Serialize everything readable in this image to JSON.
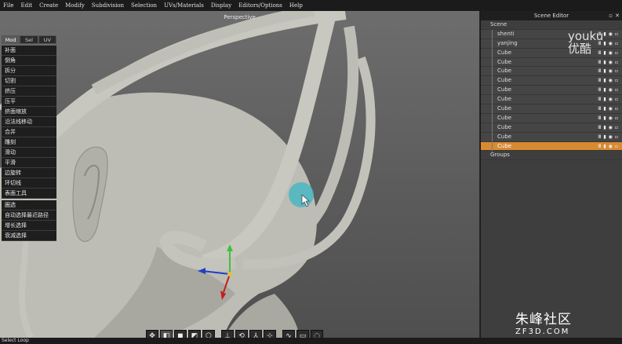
{
  "menu": [
    "File",
    "Edit",
    "Create",
    "Modify",
    "Subdivision",
    "Selection",
    "UVs/Materials",
    "Display",
    "Editors/Options",
    "Help"
  ],
  "viewport": {
    "title": "Perspective"
  },
  "left_panel": {
    "tabs": [
      "Mod",
      "Sel",
      "UV"
    ],
    "tools_group1": [
      "补面",
      "倒角",
      "拆分",
      "切割",
      "挤压",
      "压平",
      "挤面缩放",
      "沿法线移动",
      "合并",
      "雕刻",
      "滑动",
      "平滑",
      "边旋转",
      "环切线",
      "表面工具"
    ],
    "tools_group2": [
      "圈选",
      "自动选择最近路径",
      "增长选择",
      "衰减选择"
    ]
  },
  "toolbar_icons": [
    "tweak-icon",
    "face-mode-icon",
    "object-mode-icon",
    "vertex-mode-icon",
    "edge-mode-icon",
    "move-icon",
    "rotate-icon",
    "scale-icon",
    "universal-icon",
    "curve-icon",
    "rect-select-icon",
    "lasso-icon"
  ],
  "scene_editor": {
    "title": "Scene Editor",
    "root": "Scene",
    "items": [
      "shenti",
      "yanjing",
      "Cube",
      "Cube",
      "Cube",
      "Cube",
      "Cube",
      "Cube",
      "Cube",
      "Cube",
      "Cube",
      "Cube",
      "Cube"
    ],
    "selected_index": 12,
    "groups_label": "Groups"
  },
  "status": {
    "text": "Select Loop"
  },
  "watermark": {
    "line1": "朱峰社区",
    "line2": "ZF3D.COM"
  },
  "youku": {
    "line1": "youku",
    "line2": "优酷"
  }
}
